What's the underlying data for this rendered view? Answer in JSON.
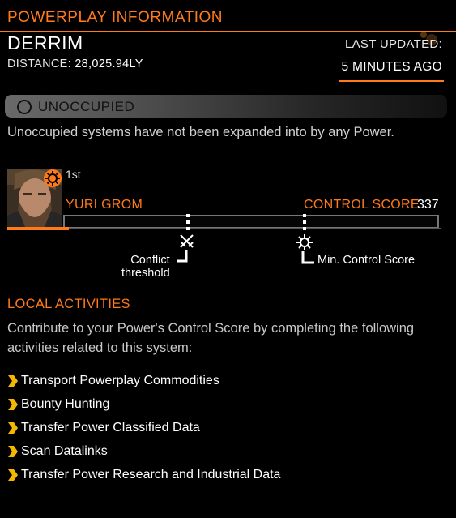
{
  "header": {
    "title": "POWERPLAY INFORMATION",
    "system_name": "DERRIM",
    "distance_label": "DISTANCE:",
    "distance_value": "28,025.94LY",
    "last_updated_label": "LAST UPDATED:",
    "last_updated_value": "5 MINUTES AGO"
  },
  "status": {
    "label": "UNOCCUPIED",
    "description": "Unoccupied systems have not been expanded into by any Power."
  },
  "power": {
    "rank": "1st",
    "leader": "YURI GROM",
    "control_score_label": "CONTROL SCORE",
    "control_score_value": "337",
    "progress_fraction": 0.04,
    "conflict_threshold_label": "Conflict threshold",
    "conflict_line1": "Conflict",
    "conflict_line2": "threshold",
    "min_control_label": "Min. Control Score",
    "conflict_icon": "crossed-swords-icon",
    "min_control_icon": "cog-icon"
  },
  "local_activities": {
    "title": "LOCAL ACTIVITIES",
    "description": "Contribute to your Power's Control Score by completing the following activities related to this system:",
    "items": [
      "Transport Powerplay Commodities",
      "Bounty Hunting",
      "Transfer Power Classified Data",
      "Scan Datalinks",
      "Transfer Power Research and Industrial Data"
    ]
  },
  "colors": {
    "accent": "#ff7a1a",
    "background": "#000000",
    "status_bar": "#6a6a6a",
    "bullet": "#f5b800"
  }
}
